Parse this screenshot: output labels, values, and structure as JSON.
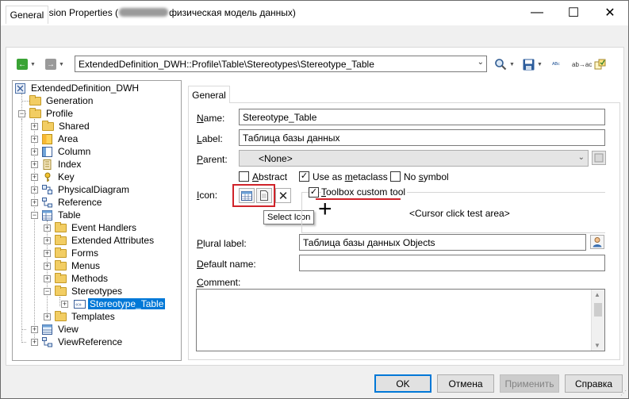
{
  "window": {
    "title_prefix": "Extension Properties (",
    "title_suffix": "физическая модель данных)",
    "minimize_glyph": "—",
    "maximize_glyph": "☐",
    "close_glyph": "✕"
  },
  "top_tab": {
    "label": "General"
  },
  "toolbar": {
    "path": "ExtendedDefinition_DWH::Profile\\Table\\Stereotypes\\Stereotype_Table",
    "icons": [
      "back-arrow-icon",
      "forward-arrow-icon",
      "find-icon",
      "save-icon",
      "spell-check-icon",
      "replace-icon",
      "check-model-icon"
    ],
    "spell_glyph": "ᴬᴮᶜ",
    "replace_glyph": "ab→ac",
    "path_arrow": "⌄",
    "nav_back": "←",
    "nav_forward": "→"
  },
  "tree": {
    "root": "ExtendedDefinition_DWH",
    "generation": "Generation",
    "profile": "Profile",
    "profile_items": [
      "Shared",
      "Area",
      "Column",
      "Index",
      "Key",
      "PhysicalDiagram",
      "Reference",
      "Table"
    ],
    "table_items": [
      "Event Handlers",
      "Extended Attributes",
      "Forms",
      "Menus",
      "Methods",
      "Stereotypes"
    ],
    "stereotype_item": "Stereotype_Table",
    "templates": "Templates",
    "view": "View",
    "view_reference": "ViewReference",
    "expander_collapsed": "+",
    "expander_expanded": "−"
  },
  "inner_tab": {
    "label": "General"
  },
  "form": {
    "name_label_u": "N",
    "name_label_rest": "ame:",
    "name_value": "Stereotype_Table",
    "label_label_u": "L",
    "label_label_rest": "abel:",
    "label_value": "Таблица базы данных",
    "parent_label_u": "P",
    "parent_label_rest": "arent:",
    "parent_value": "<None>",
    "parent_arrow": "⌄",
    "abstract_label_u": "A",
    "abstract_label_rest": "bstract",
    "abstract_checked": false,
    "metaclass_label_pre": "Use as ",
    "metaclass_label_u": "m",
    "metaclass_label_rest": "etaclass",
    "metaclass_checked": true,
    "nosymbol_label_pre": "No ",
    "nosymbol_label_u": "s",
    "nosymbol_label_rest": "ymbol",
    "nosymbol_checked": false,
    "icon_label_u": "I",
    "icon_label_rest": "con:",
    "toolbox_label_pre": "",
    "toolbox_label_u": "T",
    "toolbox_label_rest": "oolbox custom tool",
    "toolbox_checked": true,
    "check_glyph": "✓",
    "cursor_glyph": "+",
    "cursor_test_text": "<Cursor click test area>",
    "tooltip": "Select Icon",
    "delete_glyph": "✕",
    "plural_label_u": "P",
    "plural_label_rest": "lural label:",
    "plural_value": "Таблица базы данных Objects",
    "default_label_u": "D",
    "default_label_rest": "efault name:",
    "default_value": "",
    "comment_label_u": "C",
    "comment_label_rest": "omment:",
    "comment_value": "",
    "scroll_up": "▲",
    "scroll_down": "▼"
  },
  "buttons": {
    "ok": "OK",
    "cancel": "Отмена",
    "apply": "Применить",
    "help": "Справка"
  },
  "colors": {
    "accent": "#0078d7",
    "highlight": "#d0232a"
  }
}
